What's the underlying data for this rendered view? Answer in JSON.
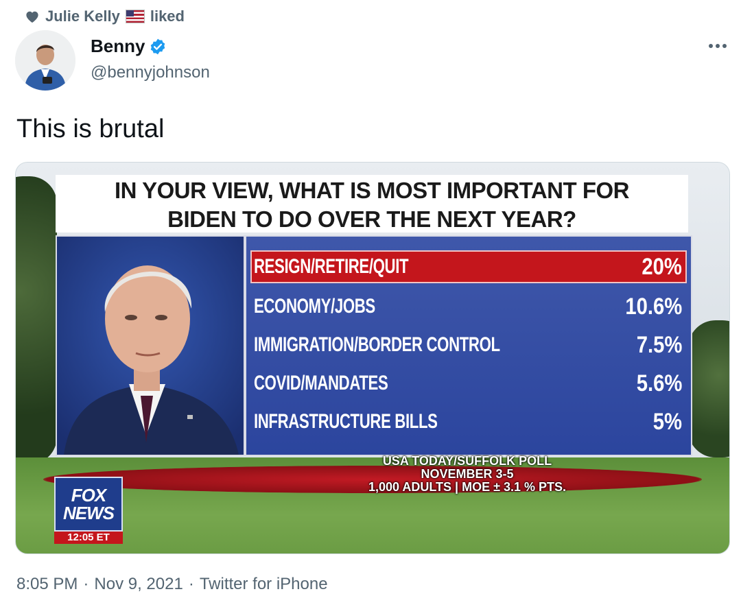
{
  "social_context": {
    "name": "Julie Kelly",
    "verb": "liked"
  },
  "author": {
    "name": "Benny",
    "handle": "@bennyjohnson"
  },
  "tweet": {
    "text": "This is brutal"
  },
  "graphic": {
    "question_line1": "IN YOUR VIEW, WHAT IS MOST IMPORTANT FOR",
    "question_line2": "BIDEN TO DO OVER THE NEXT YEAR?",
    "results": [
      {
        "label": "RESIGN/RETIRE/QUIT",
        "value": "20%"
      },
      {
        "label": "ECONOMY/JOBS",
        "value": "10.6%"
      },
      {
        "label": "IMMIGRATION/BORDER CONTROL",
        "value": "7.5%"
      },
      {
        "label": "COVID/MANDATES",
        "value": "5.6%"
      },
      {
        "label": "INFRASTRUCTURE BILLS",
        "value": "5%"
      }
    ],
    "source_line1": "USA TODAY/SUFFOLK POLL",
    "source_line2": "NOVEMBER 3-5",
    "source_line3": "1,000 ADULTS | MOE ± 3.1 % PTS.",
    "logo_line1": "FOX",
    "logo_line2": "NEWS",
    "logo_time": "12:05 ET",
    "highlight_color": "#c4161c",
    "panel_color": "#2c46a0"
  },
  "meta": {
    "time": "8:05 PM",
    "date": "Nov 9, 2021",
    "source": "Twitter for iPhone",
    "separator": "·"
  },
  "colors": {
    "secondary_text": "#536471",
    "verified_blue": "#1d9bf0"
  }
}
